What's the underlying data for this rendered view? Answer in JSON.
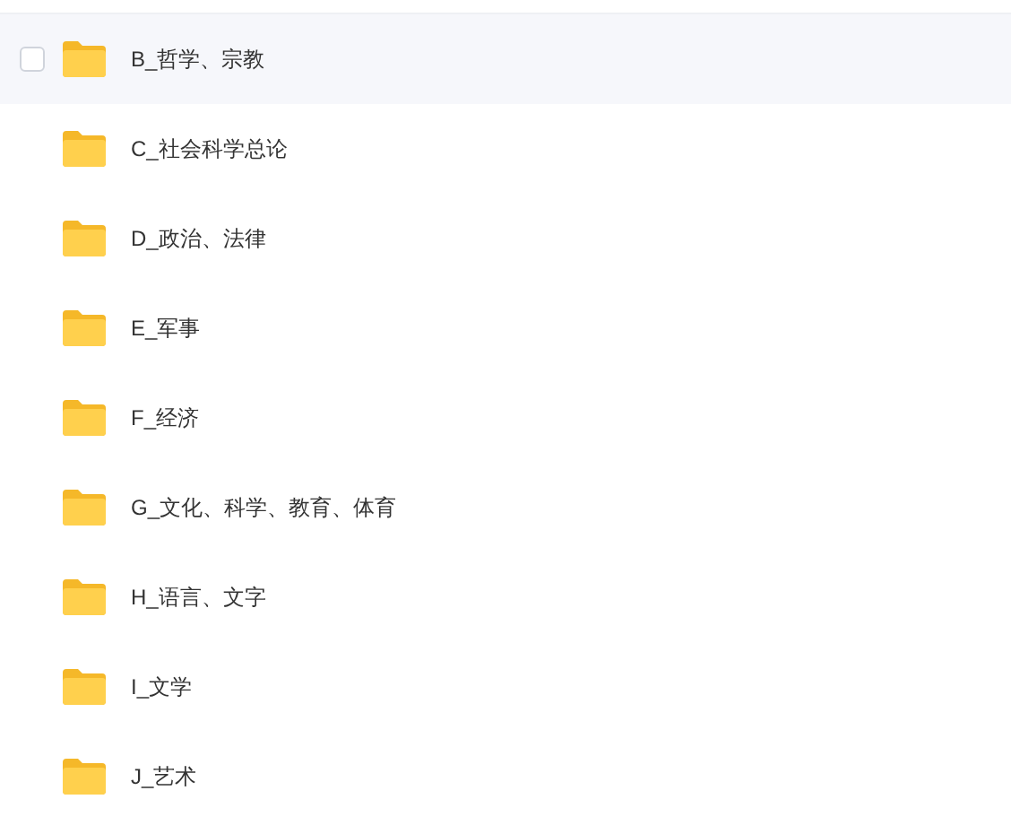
{
  "folders": [
    {
      "name": "B_哲学、宗教",
      "hovered": true,
      "checked": false
    },
    {
      "name": "C_社会科学总论",
      "hovered": false,
      "checked": false
    },
    {
      "name": "D_政治、法律",
      "hovered": false,
      "checked": false
    },
    {
      "name": "E_军事",
      "hovered": false,
      "checked": false
    },
    {
      "name": "F_经济",
      "hovered": false,
      "checked": false
    },
    {
      "name": "G_文化、科学、教育、体育",
      "hovered": false,
      "checked": false
    },
    {
      "name": "H_语言、文字",
      "hovered": false,
      "checked": false
    },
    {
      "name": "I_文学",
      "hovered": false,
      "checked": false
    },
    {
      "name": "J_艺术",
      "hovered": false,
      "checked": false
    }
  ]
}
